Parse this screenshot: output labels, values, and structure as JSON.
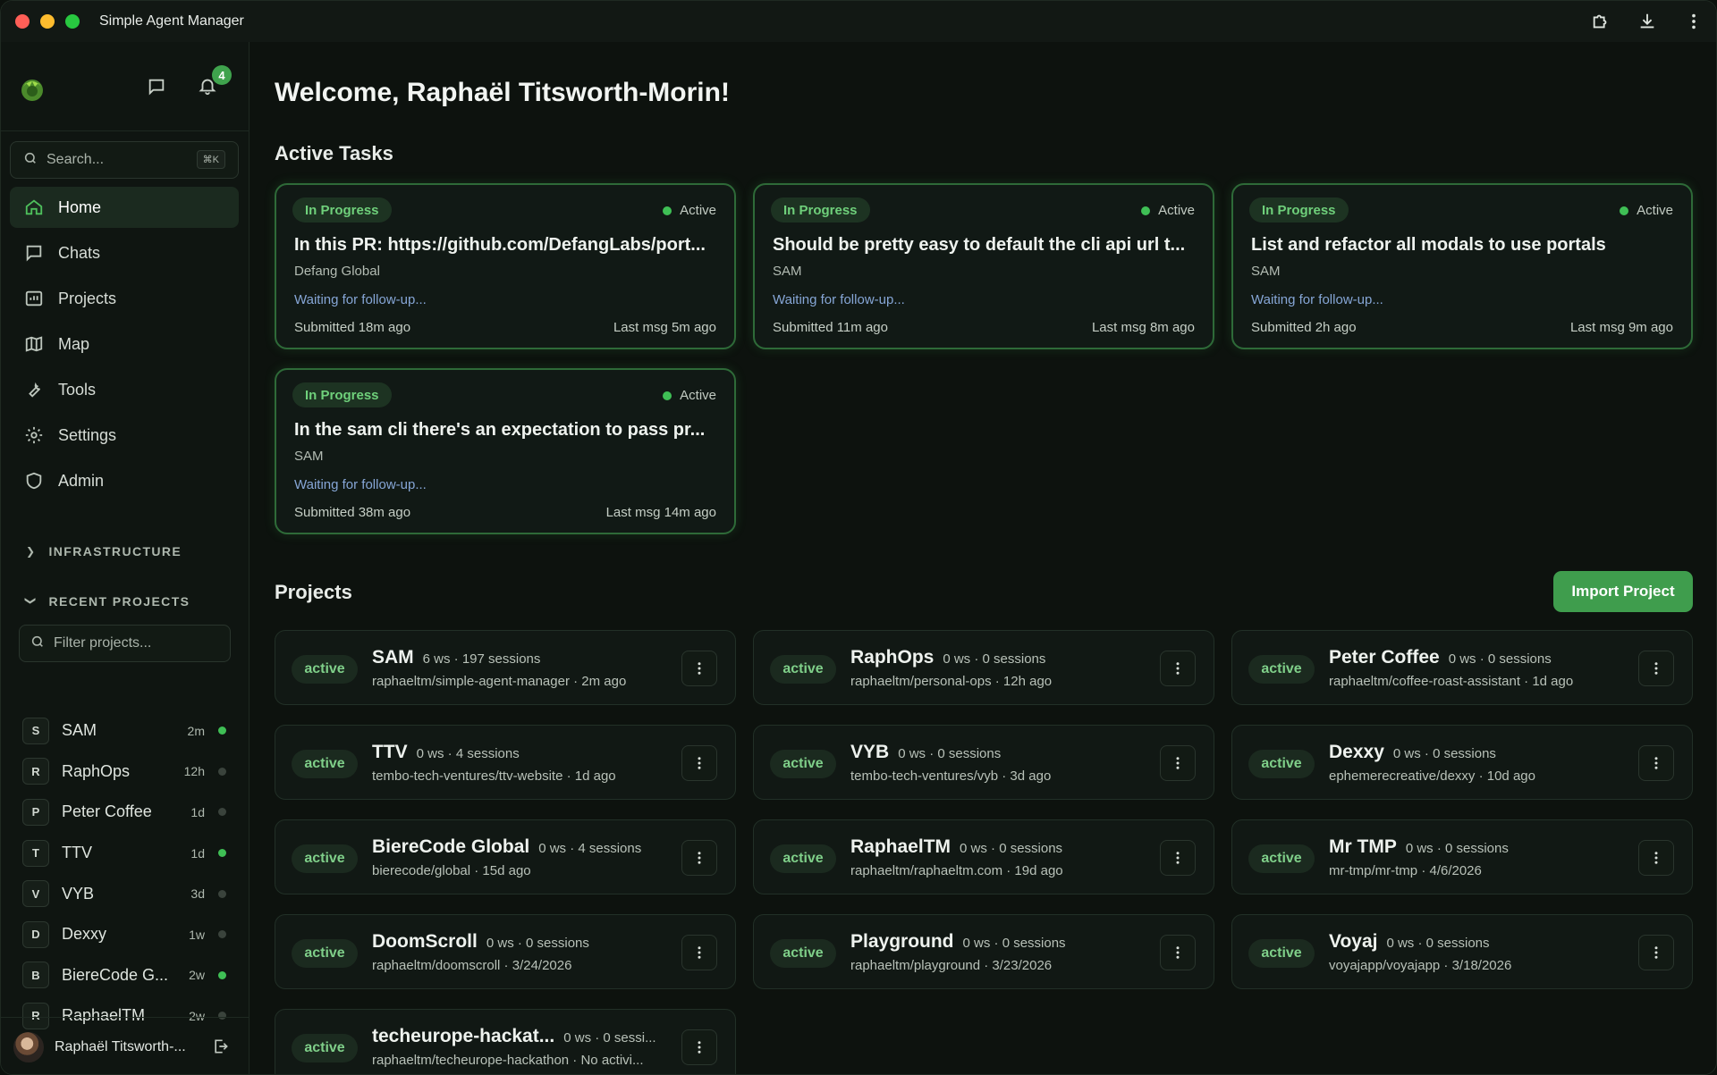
{
  "window": {
    "title": "Simple Agent Manager"
  },
  "sidebar": {
    "notification_count": "4",
    "search": {
      "placeholder": "Search...",
      "shortcut": "⌘K"
    },
    "nav": [
      {
        "label": "Home",
        "icon": "home-icon",
        "active": true
      },
      {
        "label": "Chats",
        "icon": "chat-icon"
      },
      {
        "label": "Projects",
        "icon": "projects-icon"
      },
      {
        "label": "Map",
        "icon": "map-icon"
      },
      {
        "label": "Tools",
        "icon": "wrench-icon"
      },
      {
        "label": "Settings",
        "icon": "gear-icon"
      },
      {
        "label": "Admin",
        "icon": "shield-icon"
      }
    ],
    "infrastructure_label": "INFRASTRUCTURE",
    "recent_projects_label": "RECENT PROJECTS",
    "filter_placeholder": "Filter projects...",
    "recent": [
      {
        "letter": "S",
        "name": "SAM",
        "time": "2m",
        "online": true
      },
      {
        "letter": "R",
        "name": "RaphOps",
        "time": "12h",
        "online": false
      },
      {
        "letter": "P",
        "name": "Peter Coffee",
        "time": "1d",
        "online": false
      },
      {
        "letter": "T",
        "name": "TTV",
        "time": "1d",
        "online": true
      },
      {
        "letter": "V",
        "name": "VYB",
        "time": "3d",
        "online": false
      },
      {
        "letter": "D",
        "name": "Dexxy",
        "time": "1w",
        "online": false
      },
      {
        "letter": "B",
        "name": "BiereCode G...",
        "time": "2w",
        "online": true
      },
      {
        "letter": "R",
        "name": "RaphaelTM",
        "time": "2w",
        "online": false
      }
    ],
    "user": {
      "name": "Raphaël Titsworth-..."
    }
  },
  "main": {
    "welcome": "Welcome, Raphaël Titsworth-Morin!",
    "active_tasks_heading": "Active Tasks",
    "tasks": [
      {
        "badge": "In Progress",
        "status": "Active",
        "title": "In this PR: https://github.com/DefangLabs/port...",
        "project": "Defang Global",
        "waiting": "Waiting for follow-up...",
        "submitted": "Submitted 18m ago",
        "last_msg": "Last msg 5m ago"
      },
      {
        "badge": "In Progress",
        "status": "Active",
        "title": "Should be pretty easy to default the cli api url t...",
        "project": "SAM",
        "waiting": "Waiting for follow-up...",
        "submitted": "Submitted 11m ago",
        "last_msg": "Last msg 8m ago"
      },
      {
        "badge": "In Progress",
        "status": "Active",
        "title": "List and refactor all modals to use portals",
        "project": "SAM",
        "waiting": "Waiting for follow-up...",
        "submitted": "Submitted 2h ago",
        "last_msg": "Last msg 9m ago"
      },
      {
        "badge": "In Progress",
        "status": "Active",
        "title": "In the sam cli there's an expectation to pass pr...",
        "project": "SAM",
        "waiting": "Waiting for follow-up...",
        "submitted": "Submitted 38m ago",
        "last_msg": "Last msg 14m ago"
      }
    ],
    "projects_heading": "Projects",
    "import_button": "Import Project",
    "projects": [
      {
        "status": "active",
        "name": "SAM",
        "meta": "6 ws · 197 sessions",
        "repo": "raphaeltm/simple-agent-manager · 2m ago"
      },
      {
        "status": "active",
        "name": "RaphOps",
        "meta": "0 ws · 0 sessions",
        "repo": "raphaeltm/personal-ops · 12h ago"
      },
      {
        "status": "active",
        "name": "Peter Coffee",
        "meta": "0 ws · 0 sessions",
        "repo": "raphaeltm/coffee-roast-assistant · 1d ago"
      },
      {
        "status": "active",
        "name": "TTV",
        "meta": "0 ws · 4 sessions",
        "repo": "tembo-tech-ventures/ttv-website · 1d ago"
      },
      {
        "status": "active",
        "name": "VYB",
        "meta": "0 ws · 0 sessions",
        "repo": "tembo-tech-ventures/vyb · 3d ago"
      },
      {
        "status": "active",
        "name": "Dexxy",
        "meta": "0 ws · 0 sessions",
        "repo": "ephemerecreative/dexxy · 10d ago"
      },
      {
        "status": "active",
        "name": "BiereCode Global",
        "meta": "0 ws · 4 sessions",
        "repo": "bierecode/global · 15d ago"
      },
      {
        "status": "active",
        "name": "RaphaelTM",
        "meta": "0 ws · 0 sessions",
        "repo": "raphaeltm/raphaeltm.com · 19d ago"
      },
      {
        "status": "active",
        "name": "Mr TMP",
        "meta": "0 ws · 0 sessions",
        "repo": "mr-tmp/mr-tmp · 4/6/2026"
      },
      {
        "status": "active",
        "name": "DoomScroll",
        "meta": "0 ws · 0 sessions",
        "repo": "raphaeltm/doomscroll · 3/24/2026"
      },
      {
        "status": "active",
        "name": "Playground",
        "meta": "0 ws · 0 sessions",
        "repo": "raphaeltm/playground · 3/23/2026"
      },
      {
        "status": "active",
        "name": "Voyaj",
        "meta": "0 ws · 0 sessions",
        "repo": "voyajapp/voyajapp · 3/18/2026"
      },
      {
        "status": "active",
        "name": "techeurope-hackat...",
        "meta": "0 ws · 0 sessi...",
        "repo": "raphaeltm/techeurope-hackathon · No activi..."
      }
    ]
  }
}
